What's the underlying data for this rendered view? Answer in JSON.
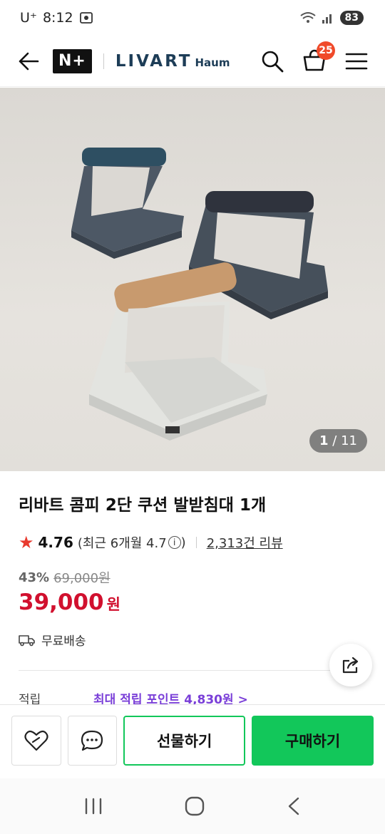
{
  "status_bar": {
    "carrier": "U⁺",
    "time": "8:12",
    "battery": "83"
  },
  "header": {
    "npay_logo": "N+",
    "brand_main": "LIVART",
    "brand_sub": "Haum",
    "cart_count": "25"
  },
  "image": {
    "current": "1",
    "total": "/ 11"
  },
  "product": {
    "title": "리바트 콤피 2단 쿠션 발받침대 1개",
    "rating": "4.76",
    "recent_rating_prefix": "(최근 6개월 4.7",
    "info_icon": "i",
    "recent_rating_suffix": ")",
    "review_count": "2,313건 리뷰",
    "discount_rate": "43%",
    "original_price": "69,000원",
    "price": "39,000",
    "currency": "원",
    "delivery": "무료배송",
    "points_label": "적립",
    "points_link": "최대 적립 포인트 4,830원 >"
  },
  "actions": {
    "gift": "선물하기",
    "buy": "구매하기"
  },
  "colors": {
    "accent_green": "#12c75a",
    "price_red": "#d1102e",
    "points_purple": "#7a3fd8",
    "badge_orange": "#f04a2a"
  }
}
